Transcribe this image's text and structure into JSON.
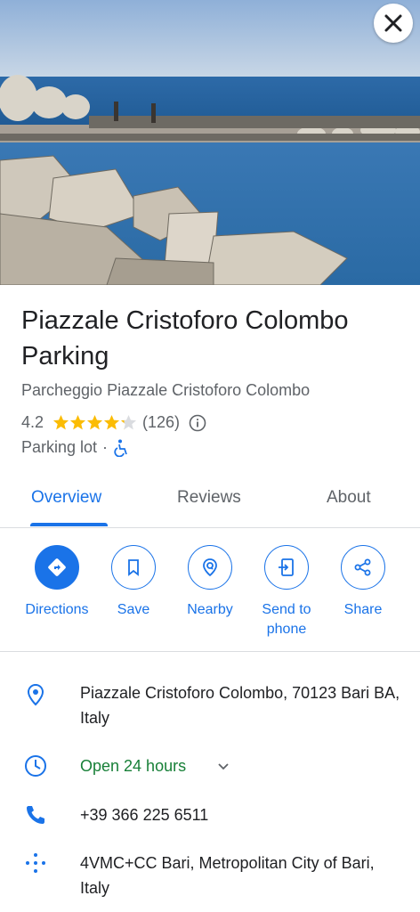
{
  "hero": {
    "close_icon": "close-icon"
  },
  "place": {
    "title": "Piazzale Cristoforo Colombo Parking",
    "subtitle": "Parcheggio Piazzale Cristoforo Colombo",
    "rating": "4.2",
    "rating_value": 4.2,
    "stars_out_of": 5,
    "review_count": "(126)",
    "type": "Parking lot",
    "separator": "·"
  },
  "tabs": [
    {
      "label": "Overview",
      "active": true
    },
    {
      "label": "Reviews",
      "active": false
    },
    {
      "label": "About",
      "active": false
    }
  ],
  "actions": [
    {
      "label": "Directions",
      "icon": "directions-icon"
    },
    {
      "label": "Save",
      "icon": "bookmark-icon"
    },
    {
      "label": "Nearby",
      "icon": "nearby-icon"
    },
    {
      "label": "Send to phone",
      "icon": "send-to-phone-icon"
    },
    {
      "label": "Share",
      "icon": "share-icon"
    }
  ],
  "details": {
    "address": "Piazzale Cristoforo Colombo, 70123 Bari BA, Italy",
    "hours": "Open 24 hours",
    "phone": "+39 366 225 6511",
    "plus_code": "4VMC+CC Bari, Metropolitan City of Bari, Italy"
  },
  "colors": {
    "accent": "#1a73e8",
    "open": "#188038",
    "star": "#fbbc04",
    "text": "#202124",
    "muted": "#5f6368"
  }
}
